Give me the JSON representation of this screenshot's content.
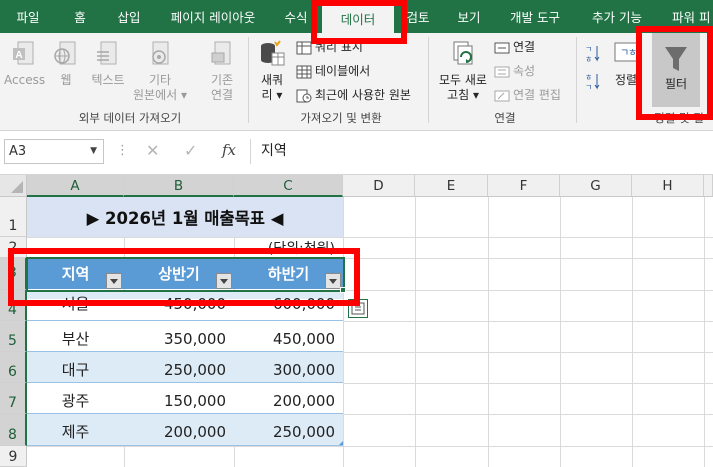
{
  "ribbon_tabs": [
    {
      "label": "파일",
      "active": false
    },
    {
      "label": "홈",
      "active": false
    },
    {
      "label": "삽입",
      "active": false
    },
    {
      "label": "페이지 레이아웃",
      "active": false
    },
    {
      "label": "수식",
      "active": false
    },
    {
      "label": "데이터",
      "active": true
    },
    {
      "label": "검토",
      "active": false
    },
    {
      "label": "보기",
      "active": false
    },
    {
      "label": "개발 도구",
      "active": false
    },
    {
      "label": "추가 기능",
      "active": false
    },
    {
      "label": "파워 피",
      "active": false
    }
  ],
  "ribbon": {
    "external_data": {
      "access": "Access",
      "web": "웹",
      "text": "텍스트",
      "other_line1": "기타",
      "other_line2": "원본에서",
      "existing_line1": "기존",
      "existing_line2": "연결",
      "group_label": "외부 데이터 가져오기"
    },
    "get_transform": {
      "new_query_line1": "새쿼",
      "new_query_line2": "리",
      "show_queries": "쿼리 표시",
      "from_table": "테이블에서",
      "recent_sources": "최근에 사용한 원본",
      "group_label": "가져오기 및 변환"
    },
    "connections": {
      "refresh_line1": "모두 새로",
      "refresh_line2": "고침",
      "connections": "연결",
      "properties": "속성",
      "edit_links": "연결 편집",
      "group_label": "연결"
    },
    "sort_filter": {
      "sort": "정렬",
      "filter": "필터",
      "group_label": "정렬 및 필"
    }
  },
  "formula_bar": {
    "name_box": "A3",
    "fx_label": "fx",
    "content": "지역"
  },
  "columns": [
    "A",
    "B",
    "C",
    "D",
    "E",
    "F",
    "G",
    "H"
  ],
  "rows": [
    "1",
    "2",
    "3",
    "4",
    "5",
    "6",
    "7",
    "8",
    "9"
  ],
  "sheet": {
    "title": "▶ 2026년 1월 매출목표 ◀",
    "unit_note": "(단위:천원)",
    "table_headers": [
      "지역",
      "상반기",
      "하반기"
    ],
    "table_rows": [
      {
        "region": "서울",
        "h1": "450,000",
        "h2": "600,000"
      },
      {
        "region": "부산",
        "h1": "350,000",
        "h2": "450,000"
      },
      {
        "region": "대구",
        "h1": "250,000",
        "h2": "300,000"
      },
      {
        "region": "광주",
        "h1": "150,000",
        "h2": "200,000"
      },
      {
        "region": "제주",
        "h1": "200,000",
        "h2": "250,000"
      }
    ]
  },
  "colors": {
    "excel_green": "#217346",
    "table_header_blue": "#5b9bd5",
    "table_band_blue": "#ddebf7",
    "title_band": "#dae3f3",
    "highlight_red": "#ff0000"
  }
}
